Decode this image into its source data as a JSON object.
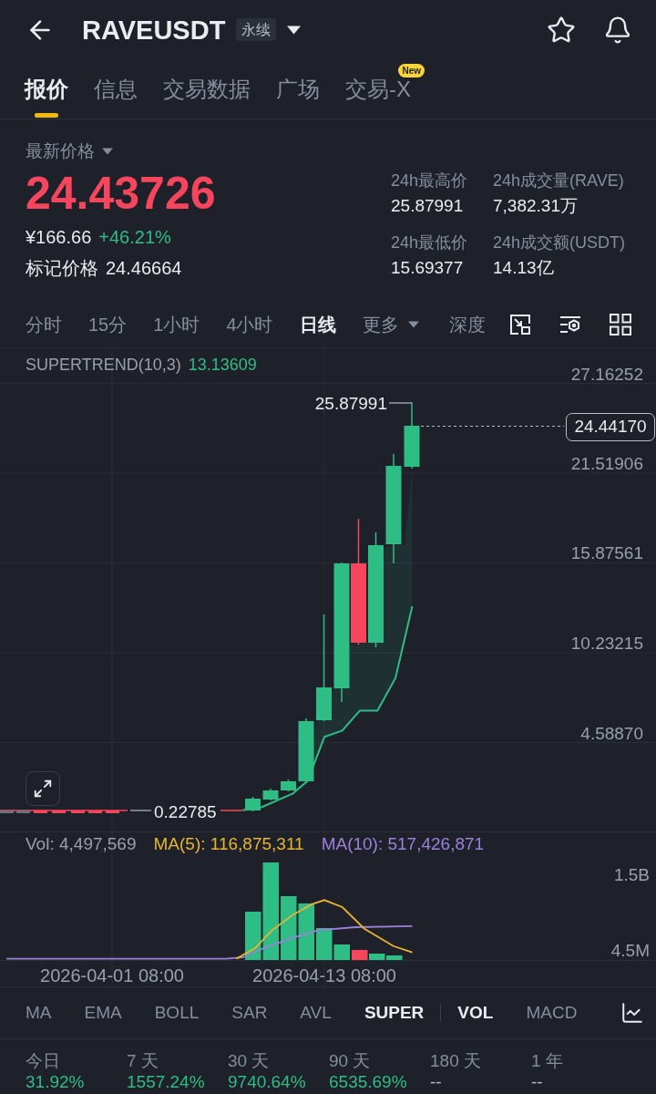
{
  "header": {
    "symbol": "RAVEUSDT",
    "badge": "永续"
  },
  "tabs": [
    {
      "label": "报价",
      "selected": true
    },
    {
      "label": "信息",
      "selected": false
    },
    {
      "label": "交易数据",
      "selected": false
    },
    {
      "label": "广场",
      "selected": false
    },
    {
      "label": "交易-X",
      "selected": false,
      "badge": "New"
    }
  ],
  "price": {
    "label": "最新价格",
    "last": "24.43726",
    "fiat": "¥166.66",
    "change": "+46.21%",
    "mark_label": "标记价格",
    "mark_price": "24.46664"
  },
  "stats": [
    {
      "label": "24h最高价",
      "value": "25.87991"
    },
    {
      "label": "24h成交量(RAVE)",
      "value": "7,382.31万"
    },
    {
      "label": "24h最低价",
      "value": "15.69377"
    },
    {
      "label": "24h成交额(USDT)",
      "value": "14.13亿"
    }
  ],
  "intervals": [
    {
      "label": "分时",
      "selected": false,
      "kind": "option"
    },
    {
      "label": "15分",
      "selected": false,
      "kind": "option"
    },
    {
      "label": "1小时",
      "selected": false,
      "kind": "option"
    },
    {
      "label": "4小时",
      "selected": false,
      "kind": "option"
    },
    {
      "label": "日线",
      "selected": true,
      "kind": "option"
    },
    {
      "label": "更多",
      "selected": false,
      "kind": "menu"
    }
  ],
  "depth": {
    "label": "深度",
    "selected": false
  },
  "chart": {
    "indicator": "SUPERTREND(10,3)",
    "indicator_value": "13.13609",
    "price_axis": [
      "27.16252",
      "21.51906",
      "15.87561",
      "10.23215",
      "4.58870"
    ],
    "high_label": "25.87991",
    "low_label": "0.22785",
    "last_price": "24.44170"
  },
  "volume": {
    "vol": "Vol: 4,497,569",
    "ma5": "MA(5): 116,875,311",
    "ma10": "MA(10): 517,426,871",
    "axis": [
      "1.5B",
      "4.5M"
    ],
    "dates": [
      "2026-04-01 08:00",
      "2026-04-13 08:00"
    ]
  },
  "main_indicators": [
    {
      "label": "MA",
      "selected": false
    },
    {
      "label": "EMA",
      "selected": false
    },
    {
      "label": "BOLL",
      "selected": false
    },
    {
      "label": "SAR",
      "selected": false
    },
    {
      "label": "AVL",
      "selected": false
    },
    {
      "label": "SUPER",
      "selected": true
    }
  ],
  "sub_indicators": [
    {
      "label": "VOL",
      "selected": true
    },
    {
      "label": "MACD",
      "selected": false
    }
  ],
  "performance": [
    {
      "period": "今日",
      "value": "31.92%",
      "kind": "up"
    },
    {
      "period": "7 天",
      "value": "1557.24%",
      "kind": "up"
    },
    {
      "period": "30 天",
      "value": "9740.64%",
      "kind": "up"
    },
    {
      "period": "90 天",
      "value": "6535.69%",
      "kind": "up"
    },
    {
      "period": "180 天",
      "value": "--",
      "kind": "none"
    },
    {
      "period": "1 年",
      "value": "--",
      "kind": "none"
    }
  ]
}
